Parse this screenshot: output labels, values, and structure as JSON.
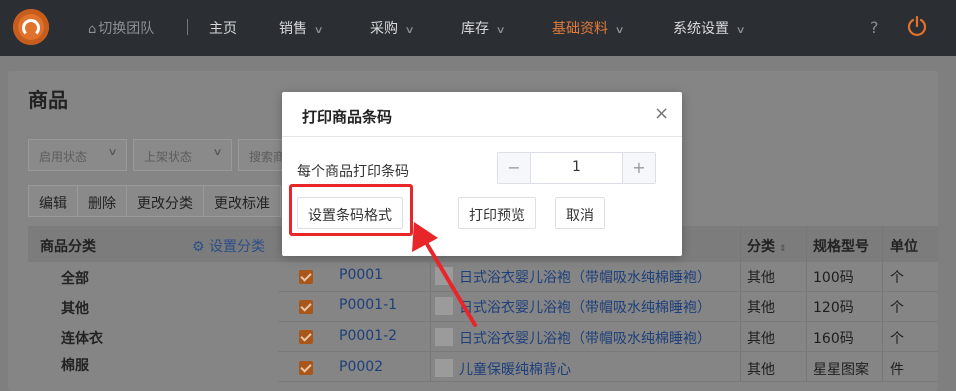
{
  "topnav": {
    "team_label": "切换团队",
    "items": [
      {
        "label": "主页",
        "dropdown": false
      },
      {
        "label": "销售",
        "dropdown": true
      },
      {
        "label": "采购",
        "dropdown": true
      },
      {
        "label": "库存",
        "dropdown": true
      },
      {
        "label": "基础资料",
        "dropdown": true,
        "active": true
      },
      {
        "label": "系统设置",
        "dropdown": true
      }
    ],
    "help_label": "?",
    "accent_color": "#e37b3a"
  },
  "page": {
    "title": "商品",
    "filters": [
      {
        "placeholder": "启用状态"
      },
      {
        "placeholder": "上架状态"
      },
      {
        "placeholder": "搜索商"
      }
    ],
    "actions": [
      "编辑",
      "删除",
      "更改分类",
      "更改标准"
    ]
  },
  "category_panel": {
    "title": "商品分类",
    "settings_label": "设置分类",
    "items": [
      "全部",
      "其他",
      "连体衣",
      "棉服"
    ]
  },
  "table": {
    "columns": {
      "category": "分类",
      "spec": "规格型号",
      "unit": "单位"
    },
    "rows": [
      {
        "checked": true,
        "code": "P0001",
        "name": "日式浴衣婴儿浴袍（带帽吸水纯棉睡袍）",
        "category": "其他",
        "spec": "100码",
        "unit": "个"
      },
      {
        "checked": true,
        "code": "P0001-1",
        "name": "日式浴衣婴儿浴袍（带帽吸水纯棉睡袍）",
        "category": "其他",
        "spec": "120码",
        "unit": "个"
      },
      {
        "checked": true,
        "code": "P0001-2",
        "name": "日式浴衣婴儿浴袍（带帽吸水纯棉睡袍）",
        "category": "其他",
        "spec": "160码",
        "unit": "个"
      },
      {
        "checked": true,
        "code": "P0002",
        "name": "儿童保暖纯棉背心",
        "category": "其他",
        "spec": "星星图案",
        "unit": "件"
      }
    ]
  },
  "modal": {
    "title": "打印商品条码",
    "copies_label": "每个商品打印条码",
    "copies_value": "1",
    "minus": "−",
    "plus": "+",
    "format_button": "设置条码格式",
    "preview_button": "打印预览",
    "cancel_button": "取消",
    "close": "×"
  },
  "annotation": {
    "highlight_color": "#e8262a"
  }
}
